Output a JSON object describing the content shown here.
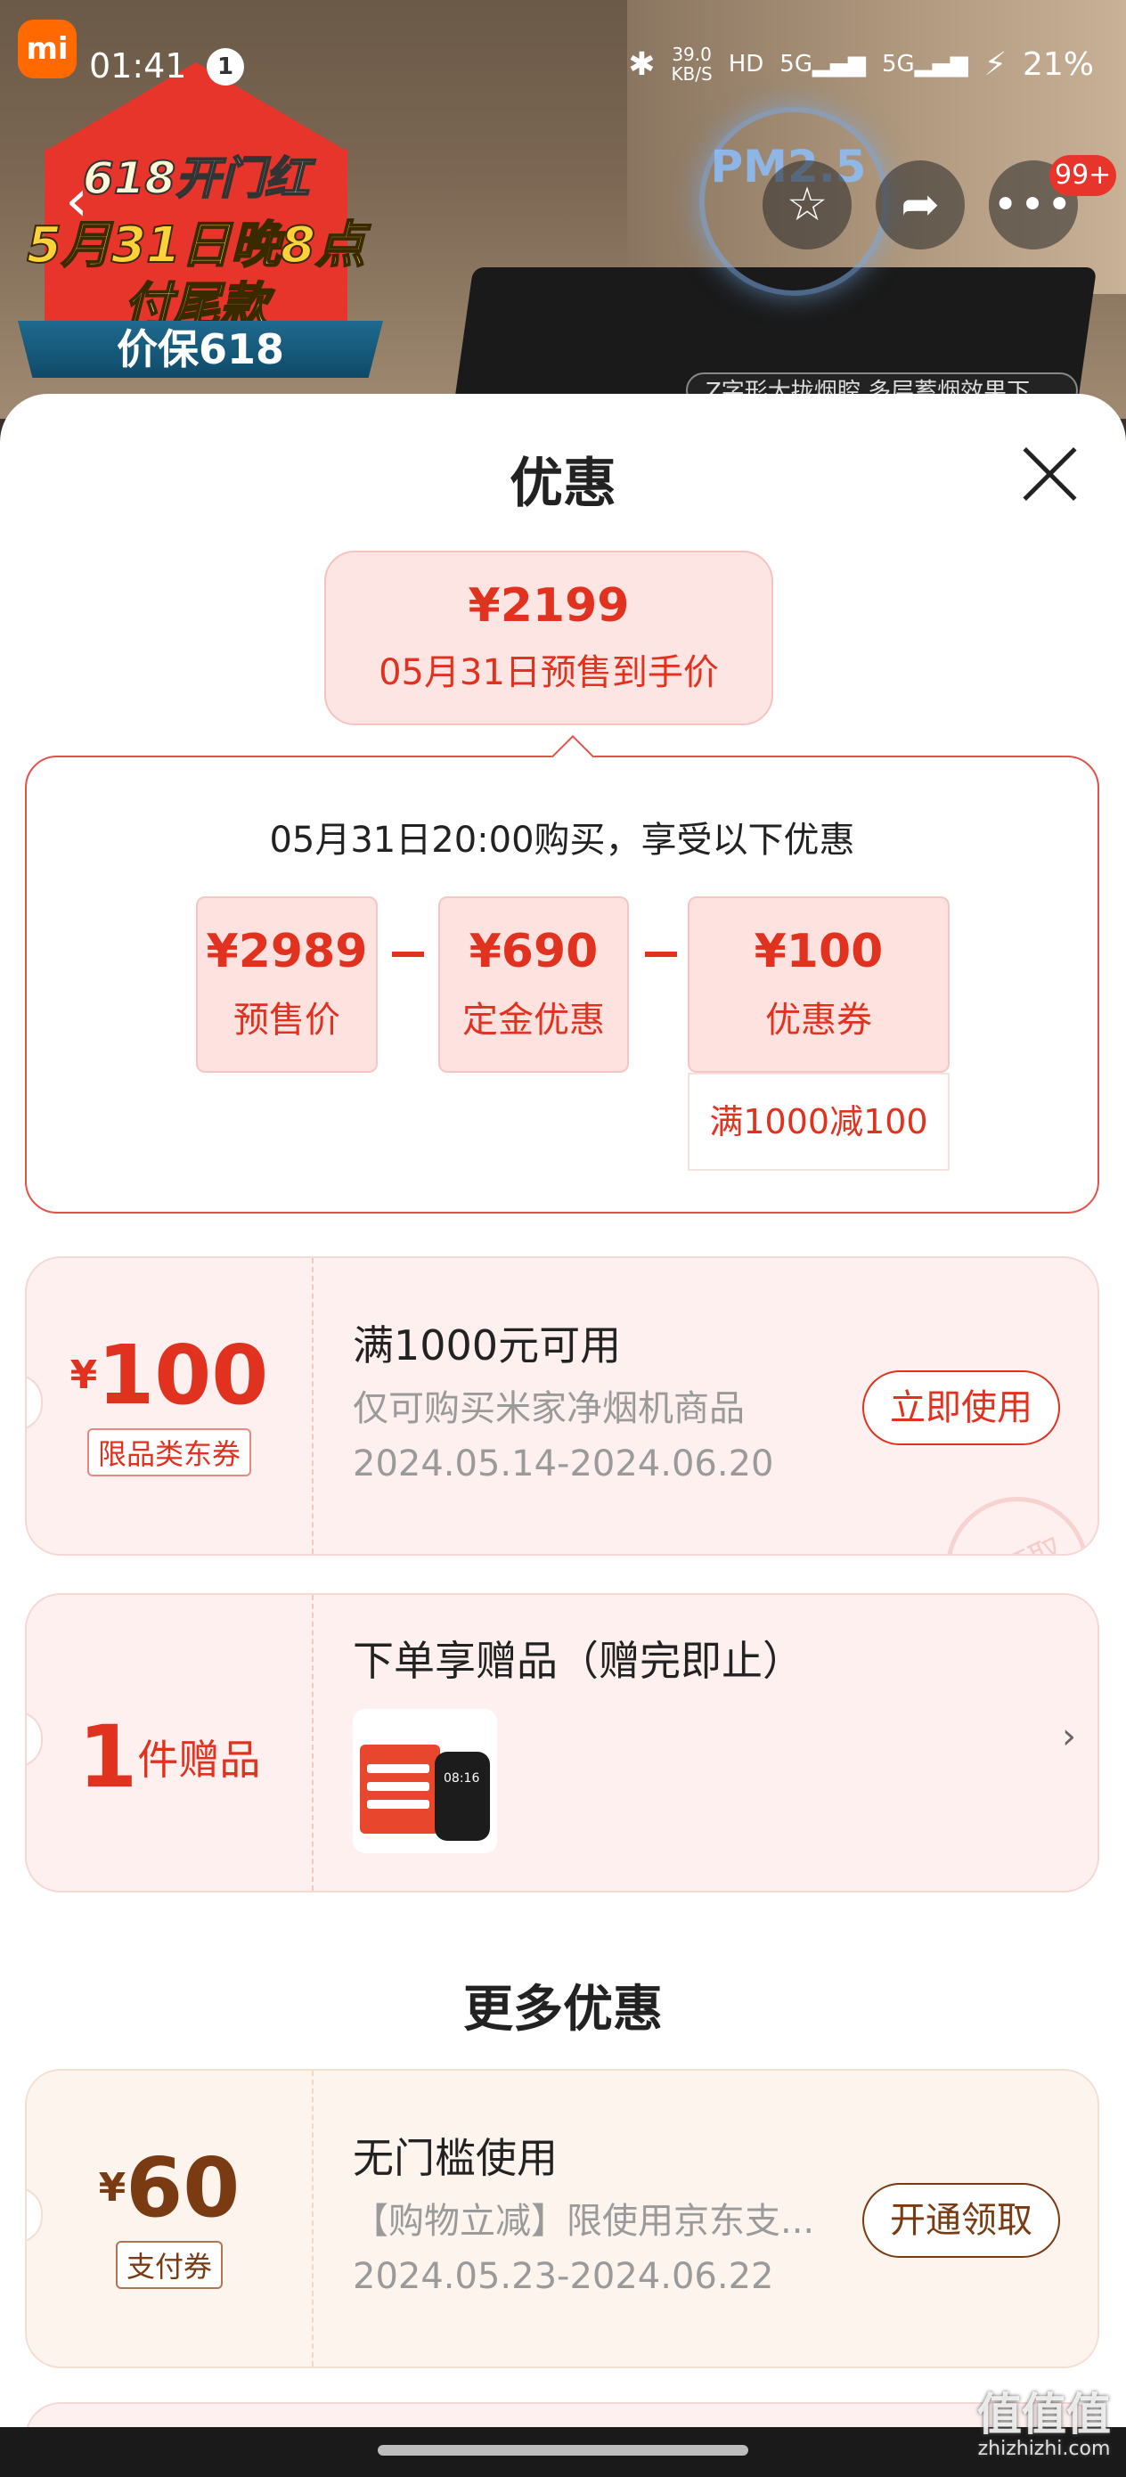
{
  "status_bar": {
    "time": "01:41",
    "notification_count": "1",
    "net_speed_value": "39.0",
    "net_speed_unit": "KB/S",
    "hd_label": "HD",
    "sig1": "5G",
    "sig2": "5G",
    "battery": "21%"
  },
  "promo_banner": {
    "line1": "618开门红",
    "line2": "5月31日晚8点",
    "line3": "付尾款",
    "ribbon": "价保618"
  },
  "product_image": {
    "pm_label": "PM2.5",
    "caption": "Z字形大拢烟腔 多层蓄烟效果下"
  },
  "nav": {
    "more_badge": "99+"
  },
  "sheet": {
    "title": "优惠",
    "price": "¥2199",
    "price_subtitle": "05月31日预售到手价",
    "detail_header": "05月31日20:00购买，享受以下优惠",
    "breakdown": [
      {
        "value": "¥2989",
        "label": "预售价"
      },
      {
        "value": "¥690",
        "label": "定金优惠"
      },
      {
        "value": "¥100",
        "label": "优惠券"
      }
    ],
    "coupon_condition": "满1000减100"
  },
  "coupon1": {
    "currency": "¥",
    "amount": "100",
    "tag": "限品类东券",
    "title": "满1000元可用",
    "desc": "仅可购买米家净烟机商品",
    "validity": "2024.05.14-2024.06.20",
    "button": "立即使用",
    "stamp": "已领取"
  },
  "gift": {
    "count": "1",
    "unit": "件赠品",
    "title": "下单享赠品（赠完即止）"
  },
  "more_title": "更多优惠",
  "coupon2": {
    "currency": "¥",
    "amount": "60",
    "tag": "支付券",
    "title": "无门槛使用",
    "desc": "【购物立减】限使用京东支...",
    "validity": "2024.05.23-2024.06.22",
    "button": "开通领取"
  },
  "watermark": {
    "main": "值值值",
    "sub": "zhizhizhi.com"
  }
}
